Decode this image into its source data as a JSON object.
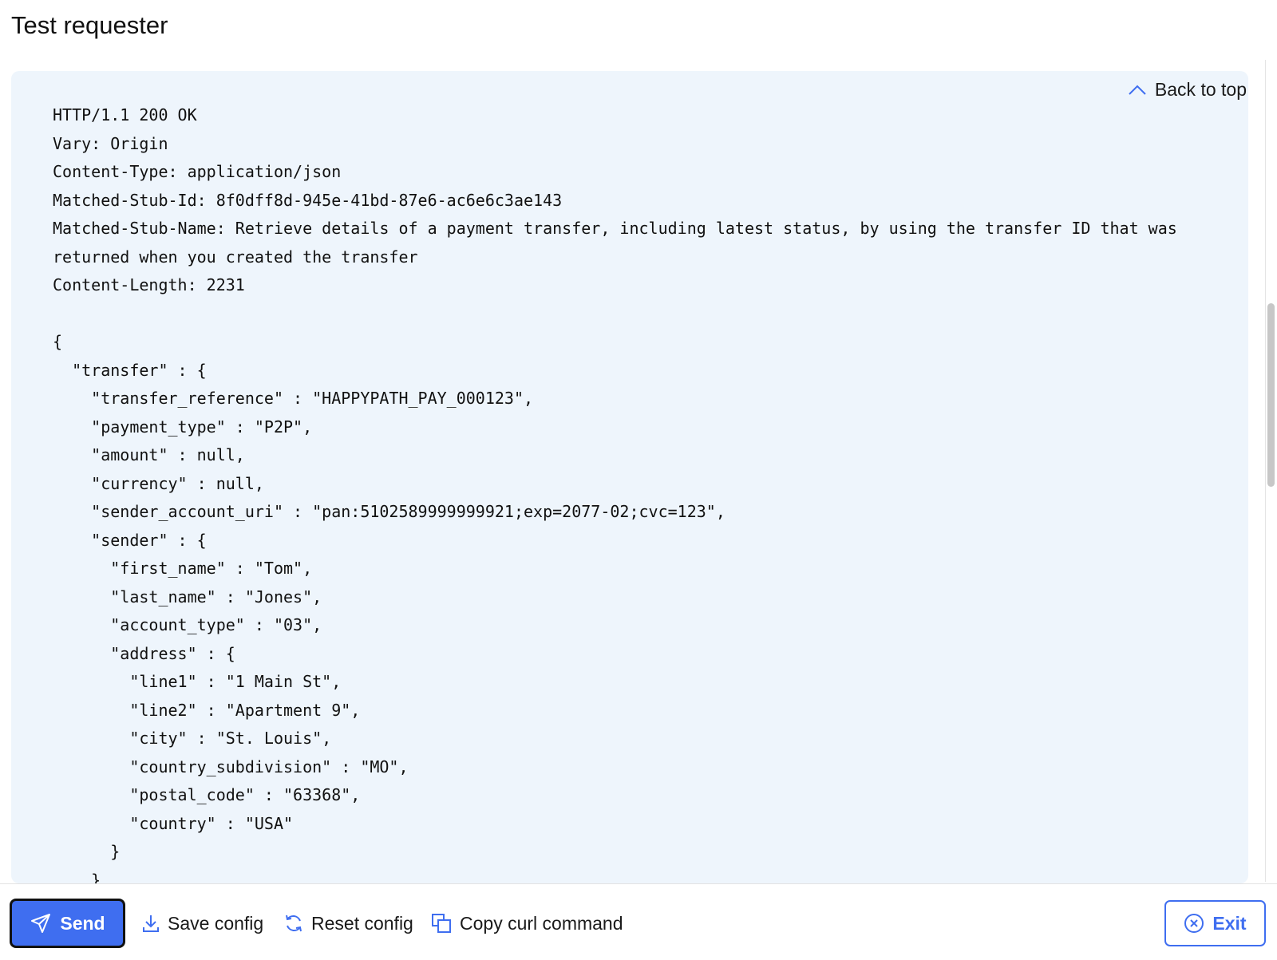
{
  "header": {
    "title": "Test requester"
  },
  "response": {
    "back_to_top_label": "Back to top",
    "lines": [
      "HTTP/1.1 200 OK",
      "Vary: Origin",
      "Content-Type: application/json",
      "Matched-Stub-Id: 8f0dff8d-945e-41bd-87e6-ac6e6c3ae143",
      "Matched-Stub-Name: Retrieve details of a payment transfer, including latest status, by using the transfer ID that was",
      "returned when you created the transfer",
      "Content-Length: 2231",
      "",
      "{",
      "  \"transfer\" : {",
      "    \"transfer_reference\" : \"HAPPYPATH_PAY_000123\",",
      "    \"payment_type\" : \"P2P\",",
      "    \"amount\" : null,",
      "    \"currency\" : null,",
      "    \"sender_account_uri\" : \"pan:5102589999999921;exp=2077-02;cvc=123\",",
      "    \"sender\" : {",
      "      \"first_name\" : \"Tom\",",
      "      \"last_name\" : \"Jones\",",
      "      \"account_type\" : \"03\",",
      "      \"address\" : {",
      "        \"line1\" : \"1 Main St\",",
      "        \"line2\" : \"Apartment 9\",",
      "        \"city\" : \"St. Louis\",",
      "        \"country_subdivision\" : \"MO\",",
      "        \"postal_code\" : \"63368\",",
      "        \"country\" : \"USA\"",
      "      }",
      "    },"
    ]
  },
  "toolbar": {
    "send_label": "Send",
    "save_config_label": "Save config",
    "reset_config_label": "Reset config",
    "copy_curl_label": "Copy curl command",
    "exit_label": "Exit"
  },
  "colors": {
    "accent": "#3f6ef0",
    "panel_background": "#eef5fc",
    "icon": "#3f6ef0"
  },
  "icons": {
    "back_to_top": "chevron-up-icon",
    "send": "paper-plane-icon",
    "save_config": "download-icon",
    "reset_config": "refresh-icon",
    "copy_curl": "copy-icon",
    "exit": "close-circle-icon"
  }
}
